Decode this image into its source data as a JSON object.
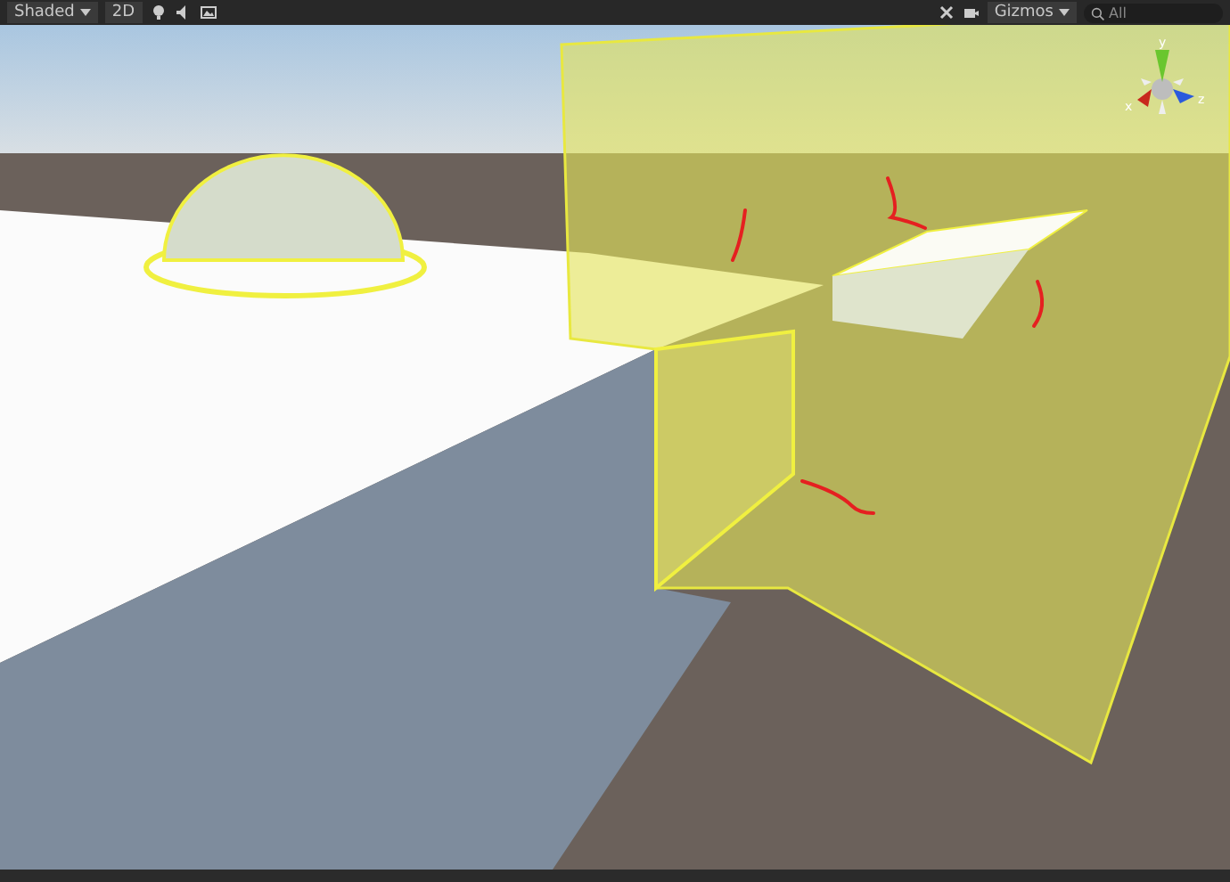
{
  "toolbar": {
    "draw_mode": "Shaded",
    "view_2d": "2D",
    "gizmos": "Gizmos",
    "search": {
      "placeholder": "All"
    }
  },
  "orientation_gizmo": {
    "axes": [
      "y",
      "x",
      "z"
    ]
  }
}
